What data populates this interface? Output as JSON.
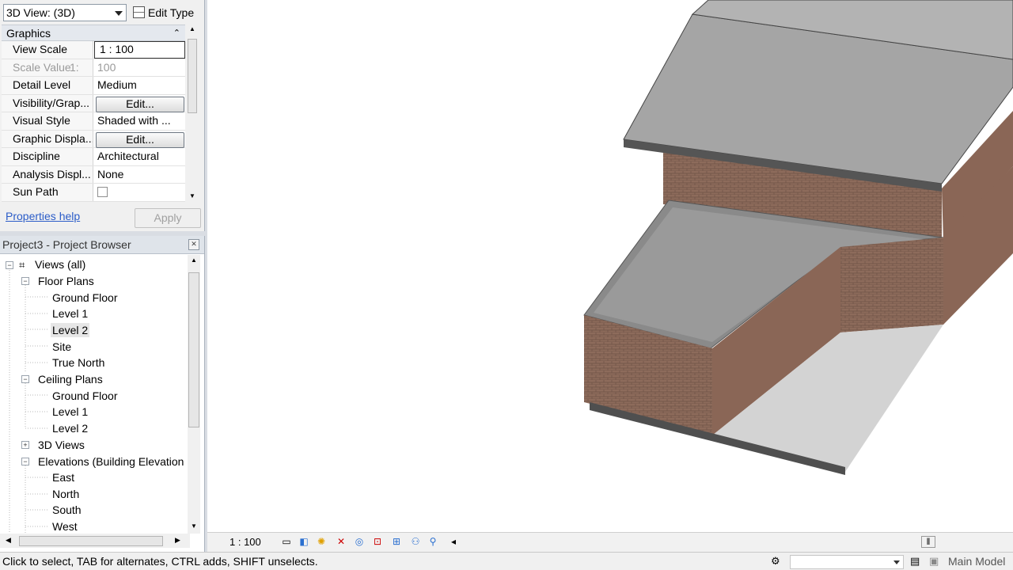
{
  "properties": {
    "view_selector": "3D View: (3D)",
    "edit_type": "Edit Type",
    "group": "Graphics",
    "rows": [
      {
        "key": "View Scale",
        "value": "1 : 100"
      },
      {
        "key": "Scale Value",
        "unit": "1:",
        "value": "100"
      },
      {
        "key": "Detail Level",
        "value": "Medium"
      },
      {
        "key": "Visibility/Grap...",
        "value": "Edit..."
      },
      {
        "key": "Visual Style",
        "value": "Shaded with ..."
      },
      {
        "key": "Graphic Displa...",
        "value": "Edit..."
      },
      {
        "key": "Discipline",
        "value": "Architectural"
      },
      {
        "key": "Analysis Displ...",
        "value": "None"
      },
      {
        "key": "Sun Path",
        "value": ""
      }
    ],
    "help_link": "Properties help",
    "apply": "Apply"
  },
  "browser": {
    "title": "Project3 - Project Browser",
    "tree": [
      {
        "label": "Views (all)",
        "level": 0
      },
      {
        "label": "Floor Plans",
        "level": 1
      },
      {
        "label": "Ground Floor",
        "level": 2
      },
      {
        "label": "Level 1",
        "level": 2
      },
      {
        "label": "Level 2",
        "level": 2
      },
      {
        "label": "Site",
        "level": 2
      },
      {
        "label": "True North",
        "level": 2
      },
      {
        "label": "Ceiling Plans",
        "level": 1
      },
      {
        "label": "Ground Floor",
        "level": 2
      },
      {
        "label": "Level 1",
        "level": 2
      },
      {
        "label": "Level 2",
        "level": 2
      },
      {
        "label": "3D Views",
        "level": 1
      },
      {
        "label": "Elevations (Building Elevation",
        "level": 1
      },
      {
        "label": "East",
        "level": 2
      },
      {
        "label": "North",
        "level": 2
      },
      {
        "label": "South",
        "level": 2
      },
      {
        "label": "West",
        "level": 2
      }
    ]
  },
  "view_bar": {
    "scale": "1 : 100"
  },
  "status": {
    "message": "Click to select, TAB for alternates, CTRL adds, SHIFT unselects.",
    "model": "Main Model"
  },
  "colors": {
    "brick": "#8a6a5a",
    "roof": "#9a9a9a",
    "slab": "#5a5a5a",
    "accent": "#2b5cc8"
  }
}
